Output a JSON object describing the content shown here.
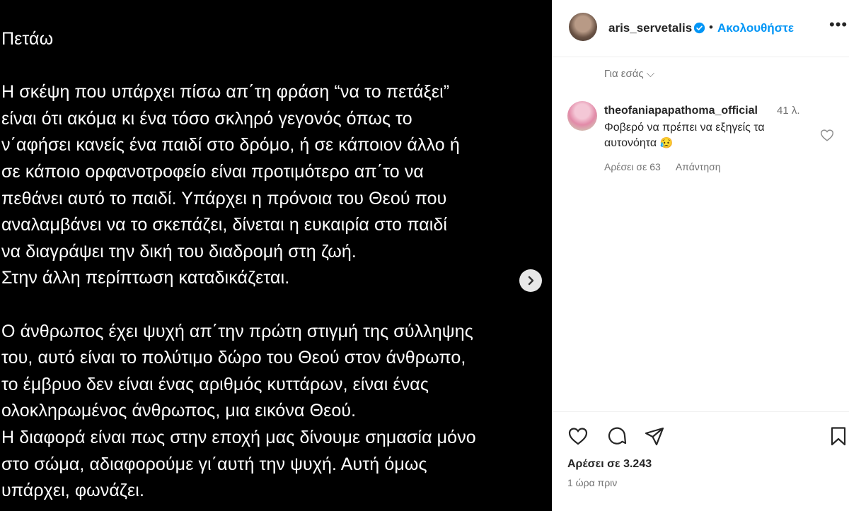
{
  "post": {
    "lines": [
      "Πετάω",
      "",
      "Η σκέψη που υπάρχει πίσω απ΄τη φράση “να το πετάξει”",
      "είναι ότι ακόμα κι ένα τόσο σκληρό γεγονός όπως το",
      "ν΄αφήσει κανείς ένα παιδί στο δρόμο, ή σε κάποιον άλλο ή",
      "σε κάποιο ορφανοτροφείο είναι προτιμότερο απ΄το να",
      "πεθάνει αυτό το παιδί. Υπάρχει η πρόνοια του Θεού που",
      "αναλαμβάνει να το σκεπάζει, δίνεται η ευκαιρία στο παιδί",
      "να διαγράψει την δική του  διαδρομή στη ζωή.",
      "Στην άλλη περίπτωση καταδικάζεται.",
      "",
      "Ο άνθρωπος έχει ψυχή απ΄την πρώτη στιγμή της σύλληψης",
      "του, αυτό είναι το πολύτιμο δώρο του Θεού στον άνθρωπο,",
      "το έμβρυο δεν είναι ένας αριθμός κυττάρων, είναι ένας",
      "ολοκληρωμένος άνθρωπος, μια εικόνα Θεού.",
      "Η διαφορά είναι πως στην εποχή μας δίνουμε σημασία μόνο",
      "στο σώμα, αδιαφορούμε γι΄αυτή την ψυχή. Αυτή όμως",
      "υπάρχει, φωνάζει."
    ],
    "next_icon": "chevron-right-icon"
  },
  "header": {
    "username": "aris_servetalis",
    "separator": "•",
    "follow_label": "Ακολουθήστε",
    "more_label": "•••"
  },
  "for_you_label": "Για εσάς ⌵",
  "comment": {
    "username": "theofaniapapathoma_official",
    "time": "41 λ.",
    "text": "Φοβερό να πρέπει να εξηγείς τα αυτονόητα",
    "emoji": "😥",
    "likes": "Αρέσει σε 63",
    "reply": "Απάντηση"
  },
  "footer": {
    "likes": "Αρέσει σε 3.243",
    "time_ago": "1 ώρα πριν"
  },
  "colors": {
    "accent": "#0095f6",
    "text": "#262626",
    "muted": "#737373"
  }
}
